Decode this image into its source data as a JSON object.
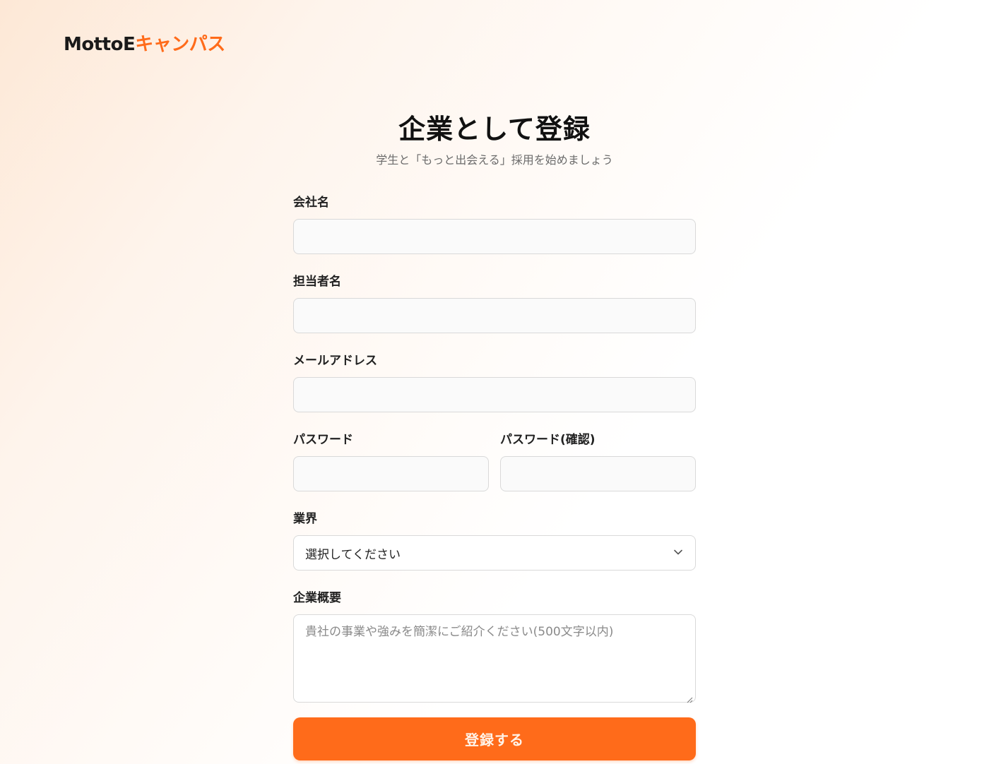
{
  "brand": {
    "name_main": "MottoE",
    "name_accent": "キャンパス",
    "accent_color": "#ff6b1a"
  },
  "header": {
    "title": "企業として登録",
    "subtitle": "学生と「もっと出会える」採用を始めましょう"
  },
  "form": {
    "company_name": {
      "label": "会社名",
      "value": "",
      "placeholder": ""
    },
    "contact_name": {
      "label": "担当者名",
      "value": "",
      "placeholder": ""
    },
    "email": {
      "label": "メールアドレス",
      "value": "",
      "placeholder": ""
    },
    "password": {
      "label": "パスワード",
      "value": "",
      "placeholder": ""
    },
    "password_confirm": {
      "label": "パスワード(確認)",
      "value": "",
      "placeholder": ""
    },
    "industry": {
      "label": "業界",
      "selected": "選択してください",
      "icon": "chevron-down-icon"
    },
    "overview": {
      "label": "企業概要",
      "placeholder": "貴社の事業や強みを簡潔にご紹介ください(500文字以内)"
    },
    "submit_label": "登録する"
  }
}
